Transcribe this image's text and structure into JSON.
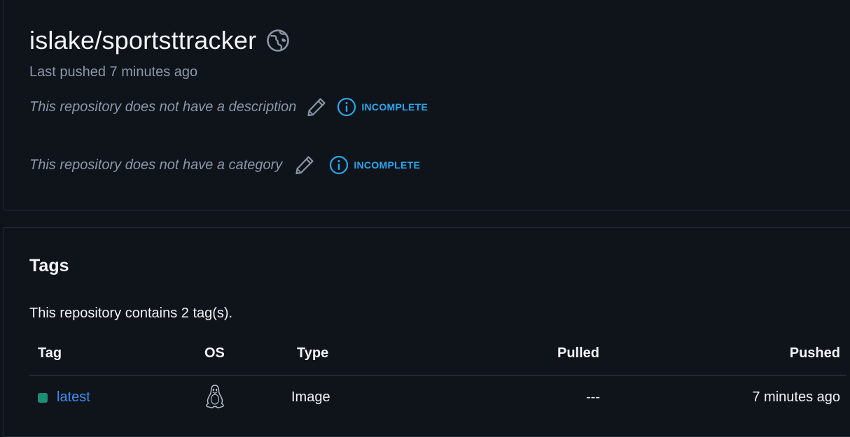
{
  "repository": {
    "name": "islake/sportsttracker",
    "last_pushed": "Last pushed 7 minutes ago",
    "visibility_icon": "globe-icon",
    "description_placeholder": "This repository does not have a description",
    "description_status": "INCOMPLETE",
    "category_placeholder": "This repository does not have a category",
    "category_status": "INCOMPLETE"
  },
  "tags": {
    "title": "Tags",
    "count_text": "This repository contains 2 tag(s).",
    "columns": {
      "tag": "Tag",
      "os": "OS",
      "type": "Type",
      "pulled": "Pulled",
      "pushed": "Pushed"
    },
    "rows": [
      {
        "tag": "latest",
        "os_icon": "linux-icon",
        "type": "Image",
        "pulled": "---",
        "pushed": "7 minutes ago"
      }
    ]
  },
  "colors": {
    "background": "#0f131a",
    "accent": "#2aa8ef",
    "link": "#3a8ff0",
    "tag_status": "#1a8f74",
    "muted_text": "#8a98ab"
  }
}
